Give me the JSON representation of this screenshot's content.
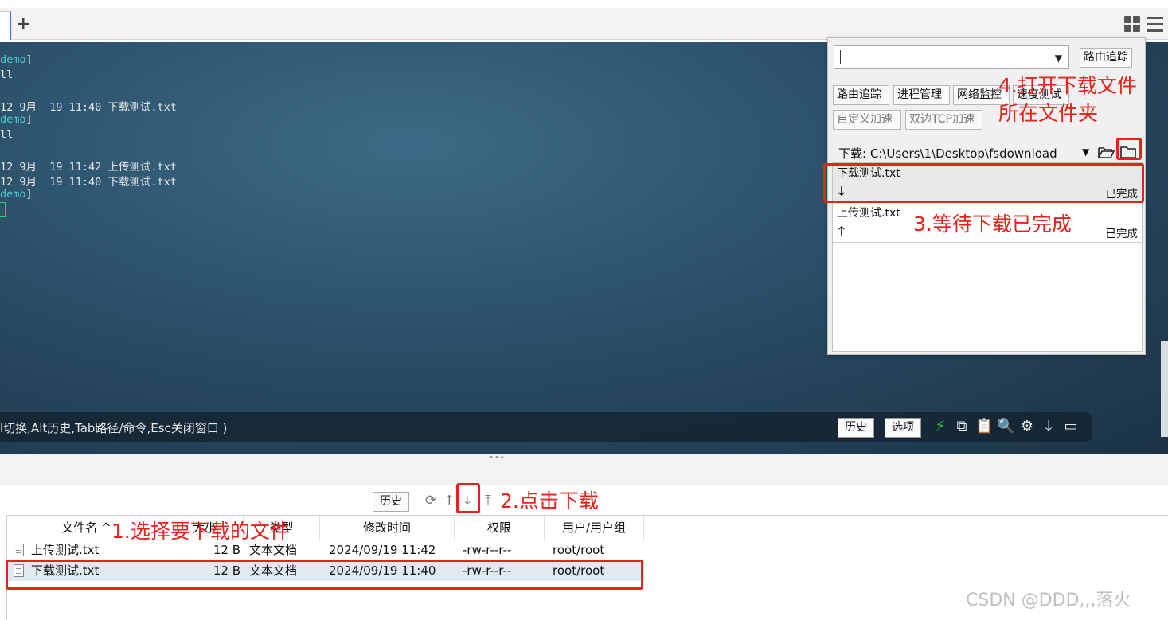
{
  "tabs": {
    "add_label": "+"
  },
  "terminal": {
    "lines": [
      {
        "prefix": "",
        "cyan": "demo",
        "rest": "]"
      },
      {
        "prefix": "ll",
        "cyan": "",
        "rest": ""
      },
      {
        "prefix": "",
        "cyan": "",
        "rest": ""
      },
      {
        "prefix": "12 9月  19 11:40 下载测试.txt",
        "cyan": "",
        "rest": ""
      },
      {
        "prefix": "",
        "cyan": "demo",
        "rest": "]"
      },
      {
        "prefix": "ll",
        "cyan": "",
        "rest": ""
      },
      {
        "prefix": "",
        "cyan": "",
        "rest": ""
      },
      {
        "prefix": "12 9月  19 11:42 上传测试.txt",
        "cyan": "",
        "rest": ""
      },
      {
        "prefix": "12 9月  19 11:40 下载测试.txt",
        "cyan": "",
        "rest": ""
      },
      {
        "prefix": "",
        "cyan": "demo",
        "rest": "]"
      }
    ],
    "hint": "l切换,Alt历史,Tab路径/命令,Esc关闭窗口 )",
    "history_label": "历史",
    "options_label": "选项"
  },
  "panel": {
    "input_value": "",
    "route_trace_label": "路由追踪",
    "tools": [
      "路由追踪",
      "进程管理",
      "网络监控",
      "速度测试"
    ],
    "tools2": [
      "自定义加速",
      "双边TCP加速"
    ],
    "download_label": "下载:",
    "download_path": "C:\\Users\\1\\Desktop\\fsdownload",
    "transfers": [
      {
        "name": "下载测试.txt",
        "arrow": "🡓",
        "status": "已完成"
      },
      {
        "name": "上传测试.txt",
        "arrow": "🡑",
        "status": "已完成"
      }
    ]
  },
  "files": {
    "history_label": "历史",
    "columns": [
      "文件名",
      "大小",
      "类型",
      "修改时间",
      "权限",
      "用户/用户组"
    ],
    "rows": [
      {
        "name": "上传测试.txt",
        "size": "12 B",
        "type": "文本文档",
        "mtime": "2024/09/19 11:42",
        "perm": "-rw-r--r--",
        "owner": "root/root"
      },
      {
        "name": "下载测试.txt",
        "size": "12 B",
        "type": "文本文档",
        "mtime": "2024/09/19 11:40",
        "perm": "-rw-r--r--",
        "owner": "root/root"
      }
    ]
  },
  "annotations": {
    "step1": "1.选择要下载的文件",
    "step2": "2.点击下载",
    "step3": "3.等待下载已完成",
    "step4_line1": "4.打开下载文件",
    "step4_line2": "所在文件夹"
  },
  "watermark": "CSDN @DDD,,,落火",
  "colors": {
    "annotation": "#e8211a",
    "accent": "#3a7bd5",
    "lightning": "#2ecc40"
  }
}
